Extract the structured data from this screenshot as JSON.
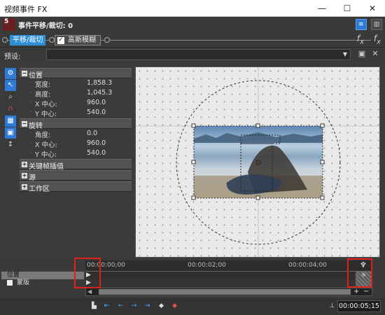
{
  "window": {
    "title": "视频事件 FX"
  },
  "header": {
    "badge_number": "5",
    "title": "事件平移/裁切: 0"
  },
  "fx_chain": {
    "crop_fx": "平移/裁切",
    "blur_fx": "高斯模糊",
    "blur_checked": true
  },
  "preset": {
    "label": "预设:",
    "value": ""
  },
  "sections": {
    "position": "位置",
    "rotation": "旋转",
    "keyframe_interp": "关键帧插值",
    "source": "源",
    "workspace": "工作区"
  },
  "position_props": [
    {
      "key": "宽度:",
      "value": "1,858.3"
    },
    {
      "key": "高度:",
      "value": "1,045.3"
    },
    {
      "key": "X 中心:",
      "value": "960.0"
    },
    {
      "key": "Y 中心:",
      "value": "540.0"
    }
  ],
  "rotation_props": [
    {
      "key": "角度:",
      "value": "0.0"
    },
    {
      "key": "X 中心:",
      "value": "960.0"
    },
    {
      "key": "Y 中心:",
      "value": "540.0"
    }
  ],
  "timeline": {
    "ticks": [
      "00:00:00;00",
      "00:00:02;00",
      "00:00:04;00"
    ],
    "track_position": "位置",
    "track_mask": "蒙版",
    "timecode": "00:00:05;15"
  },
  "icons": {
    "settings": "gear-icon",
    "pointer": "pointer-icon",
    "zoom": "zoom-icon",
    "magnet": "magnet-icon",
    "save": "save-icon",
    "delete": "delete-icon"
  },
  "colors": {
    "accent": "#2d7bd6",
    "badge": "#6b1f22",
    "highlight": "#e0201a"
  }
}
